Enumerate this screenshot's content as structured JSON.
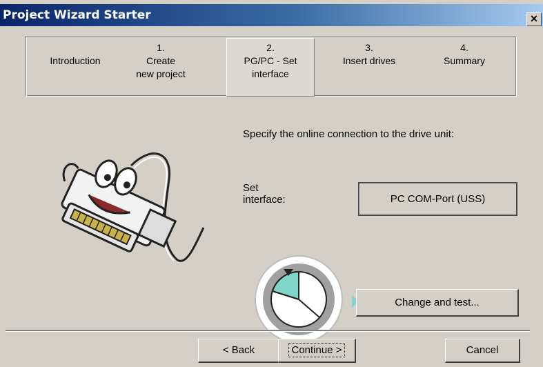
{
  "window": {
    "title": "Project Wizard Starter",
    "close_glyph": "✕"
  },
  "steps": [
    {
      "label": "Introduction",
      "number": "",
      "active": false
    },
    {
      "label": "Create new project",
      "number": "1.",
      "active": false
    },
    {
      "label": "PG/PC - Set interface",
      "number": "2.",
      "active": true
    },
    {
      "label": "Insert drives",
      "number": "3.",
      "active": false
    },
    {
      "label": "Summary",
      "number": "4.",
      "active": false
    }
  ],
  "steps_text": {
    "intro": "Introduction",
    "s1_num": "1.",
    "s1_line1": "Create",
    "s1_line2": "new project",
    "s2_num": "2.",
    "s2_line1": "PG/PC - Set",
    "s2_line2": "interface",
    "s3_num": "3.",
    "s3_line1": "Insert drives",
    "s4_num": "4.",
    "s4_line1": "Summary"
  },
  "main": {
    "prompt": "Specify the online connection to the drive unit:",
    "interface_label_line1": "Set",
    "interface_label_line2": "interface:",
    "interface_value": "PC COM-Port (USS)",
    "change_button": "Change and test..."
  },
  "footer": {
    "back": "< Back",
    "continue": "Continue >",
    "cancel": "Cancel"
  },
  "icons": {
    "mascot": "connector-cable-mascot",
    "mouse": "mouse-left-click-icon"
  },
  "colors": {
    "title_gradient_start": "#0a246a",
    "title_gradient_end": "#a6caf0",
    "dialog_bg": "#d4d0c8",
    "mouse_accent": "#7fd6c8"
  }
}
